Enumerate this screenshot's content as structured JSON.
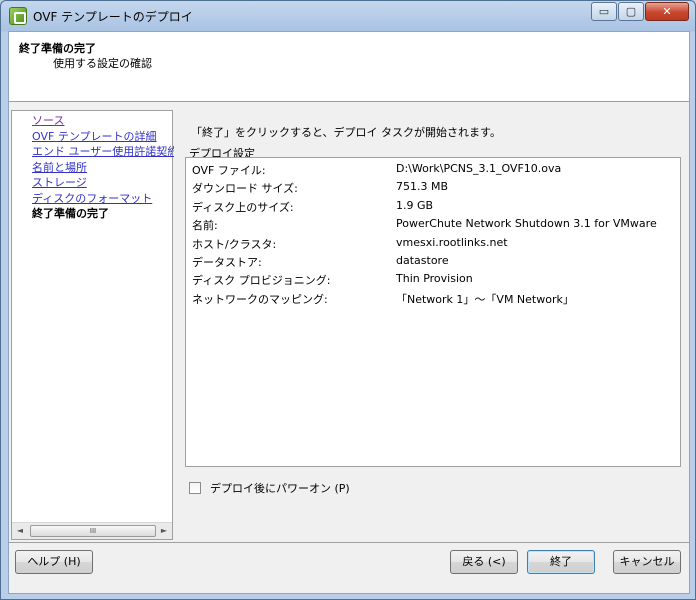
{
  "window": {
    "title": "OVF テンプレートのデプロイ",
    "minimize": "▭",
    "maximize": "▢",
    "close": "✕"
  },
  "header": {
    "title": "終了準備の完了",
    "subtitle": "使用する設定の確認"
  },
  "nav": {
    "items": [
      {
        "label": "ソース"
      },
      {
        "label": "OVF テンプレートの詳細"
      },
      {
        "label": "エンド ユーザー使用許諾契約書"
      },
      {
        "label": "名前と場所"
      },
      {
        "label": "ストレージ"
      },
      {
        "label": "ディスクのフォーマット"
      },
      {
        "label": "終了準備の完了"
      }
    ],
    "current_index": 6,
    "scroll_left": "◄",
    "scroll_right": "►",
    "scroll_grip": "III"
  },
  "main": {
    "intro": "「終了」をクリックすると、デプロイ タスクが開始されます。",
    "group_label": "デプロイ設定",
    "rows": [
      {
        "key": "OVF ファイル:",
        "value": "D:\\Work\\PCNS_3.1_OVF10.ova"
      },
      {
        "key": "ダウンロード サイズ:",
        "value": "751.3 MB"
      },
      {
        "key": "ディスク上のサイズ:",
        "value": "1.9 GB"
      },
      {
        "key": "名前:",
        "value": "PowerChute Network Shutdown 3.1 for VMware"
      },
      {
        "key": "ホスト/クラスタ:",
        "value": "vmesxi.rootlinks.net"
      },
      {
        "key": "データストア:",
        "value": "datastore"
      },
      {
        "key": "ディスク プロビジョニング:",
        "value": "Thin Provision"
      },
      {
        "key": "ネットワークのマッピング:",
        "value": "「Network 1」～「VM Network」"
      }
    ],
    "power_on_label": "デプロイ後にパワーオン (P)",
    "power_on_checked": false
  },
  "buttons": {
    "help": "ヘルプ (H)",
    "back": "戻る (<)",
    "finish": "終了",
    "cancel": "キャンセル"
  }
}
